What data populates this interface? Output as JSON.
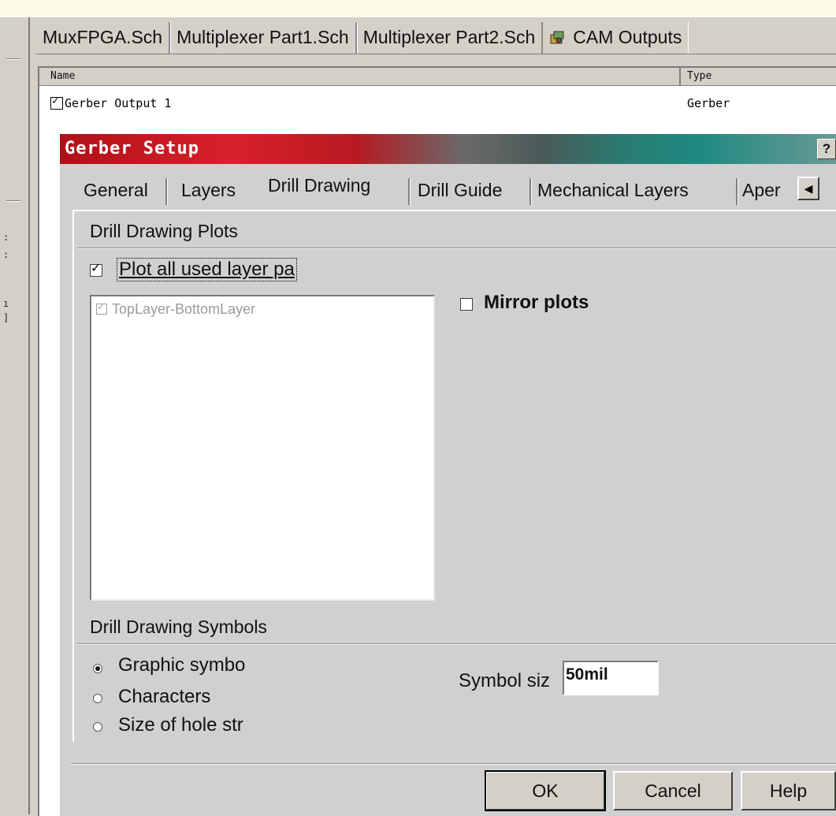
{
  "document_tabs": [
    {
      "label": "MuxFPGA.Sch"
    },
    {
      "label": "Multiplexer Part1.Sch"
    },
    {
      "label": "Multiplexer Part2.Sch"
    },
    {
      "label": "CAM Outputs",
      "icon": "cam-outputs-icon"
    }
  ],
  "list": {
    "columns": [
      "Name",
      "Type"
    ],
    "rows": [
      {
        "checked": true,
        "name": "Gerber Output 1",
        "type": "Gerber"
      }
    ]
  },
  "dialog": {
    "title": "Gerber Setup",
    "help_label": "?",
    "tabs": [
      "General",
      "Layers",
      "Drill Drawing",
      "Drill Guide",
      "Mechanical Layers",
      "Aper"
    ],
    "active_tab": "Drill Drawing",
    "drill_drawing_plots": {
      "group_title": "Drill Drawing Plots",
      "plot_all_used_label": "Plot all used layer pa",
      "plot_all_used_checked": true,
      "layer_pairs": [
        {
          "label": "TopLayer-BottomLayer",
          "checked": true,
          "enabled": false
        }
      ],
      "mirror_plots_label": "Mirror plots",
      "mirror_plots_checked": false
    },
    "drill_drawing_symbols": {
      "group_title": "Drill Drawing Symbols",
      "options": [
        {
          "label": "Graphic symbo",
          "selected": true
        },
        {
          "label": "Characters",
          "selected": false
        },
        {
          "label": "Size of hole str",
          "selected": false
        }
      ],
      "symbol_size_label": "Symbol siz",
      "symbol_size_value": "50mil"
    },
    "buttons": {
      "ok": "OK",
      "cancel": "Cancel",
      "help": "Help"
    }
  },
  "colors": {
    "title_gradient_start": "#b01018",
    "title_gradient_end": "#1d8a80",
    "face": "#d4d0c8"
  }
}
